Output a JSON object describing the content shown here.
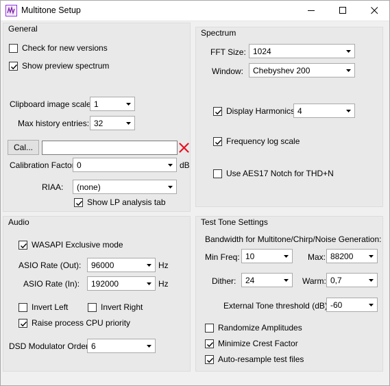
{
  "window": {
    "title": "Multitone Setup"
  },
  "general": {
    "title": "General",
    "check_versions": {
      "label": "Check for new versions",
      "checked": false
    },
    "show_preview": {
      "label": "Show preview spectrum",
      "checked": true
    },
    "clipboard_scale": {
      "label": "Clipboard image scale:",
      "value": "1"
    },
    "max_history": {
      "label": "Max history entries:",
      "value": "32"
    },
    "cal_button": "Cal...",
    "cal_path_value": "",
    "calibration_factor": {
      "label": "Calibration Factor:",
      "value": "0",
      "unit": "dB"
    },
    "riaa": {
      "label": "RIAA:",
      "value": "(none)"
    },
    "show_lp": {
      "label": "Show LP analysis tab",
      "checked": true
    }
  },
  "spectrum": {
    "title": "Spectrum",
    "fft_size": {
      "label": "FFT Size:",
      "value": "1024"
    },
    "window_fn": {
      "label": "Window:",
      "value": "Chebyshev 200"
    },
    "display_harmonics": {
      "label": "Display Harmonics",
      "checked": true,
      "value": "4"
    },
    "freq_log": {
      "label": "Frequency log scale",
      "checked": true
    },
    "aes17": {
      "label": "Use AES17 Notch for THD+N",
      "checked": false
    }
  },
  "audio": {
    "title": "Audio",
    "wasapi": {
      "label": "WASAPI Exclusive mode",
      "checked": true
    },
    "asio_out": {
      "label": "ASIO Rate (Out):",
      "value": "96000",
      "unit": "Hz"
    },
    "asio_in": {
      "label": "ASIO Rate (In):",
      "value": "192000",
      "unit": "Hz"
    },
    "invert_left": {
      "label": "Invert Left",
      "checked": false
    },
    "invert_right": {
      "label": "Invert Right",
      "checked": false
    },
    "raise_cpu": {
      "label": "Raise process CPU priority",
      "checked": true
    },
    "dsd_order": {
      "label": "DSD Modulator Order:",
      "value": "6"
    }
  },
  "test_tone": {
    "title": "Test Tone Settings",
    "bandwidth_label": "Bandwidth for Multitone/Chirp/Noise Generation:",
    "min_freq": {
      "label": "Min Freq:",
      "value": "10"
    },
    "max_freq": {
      "label": "Max:",
      "value": "88200"
    },
    "dither": {
      "label": "Dither:",
      "value": "24"
    },
    "warm": {
      "label": "Warm:",
      "value": "0,7"
    },
    "ext_threshold": {
      "label": "External Tone threshold (dB):",
      "value": "-60"
    },
    "randomize": {
      "label": "Randomize Amplitudes",
      "checked": false
    },
    "minimize_crest": {
      "label": "Minimize Crest Factor",
      "checked": true
    },
    "auto_resample": {
      "label": "Auto-resample test files",
      "checked": true
    }
  },
  "colors": {
    "accent_clear": "#e81123",
    "group_bg": "#e9e9e9",
    "window_bg": "#f0f0f0"
  }
}
